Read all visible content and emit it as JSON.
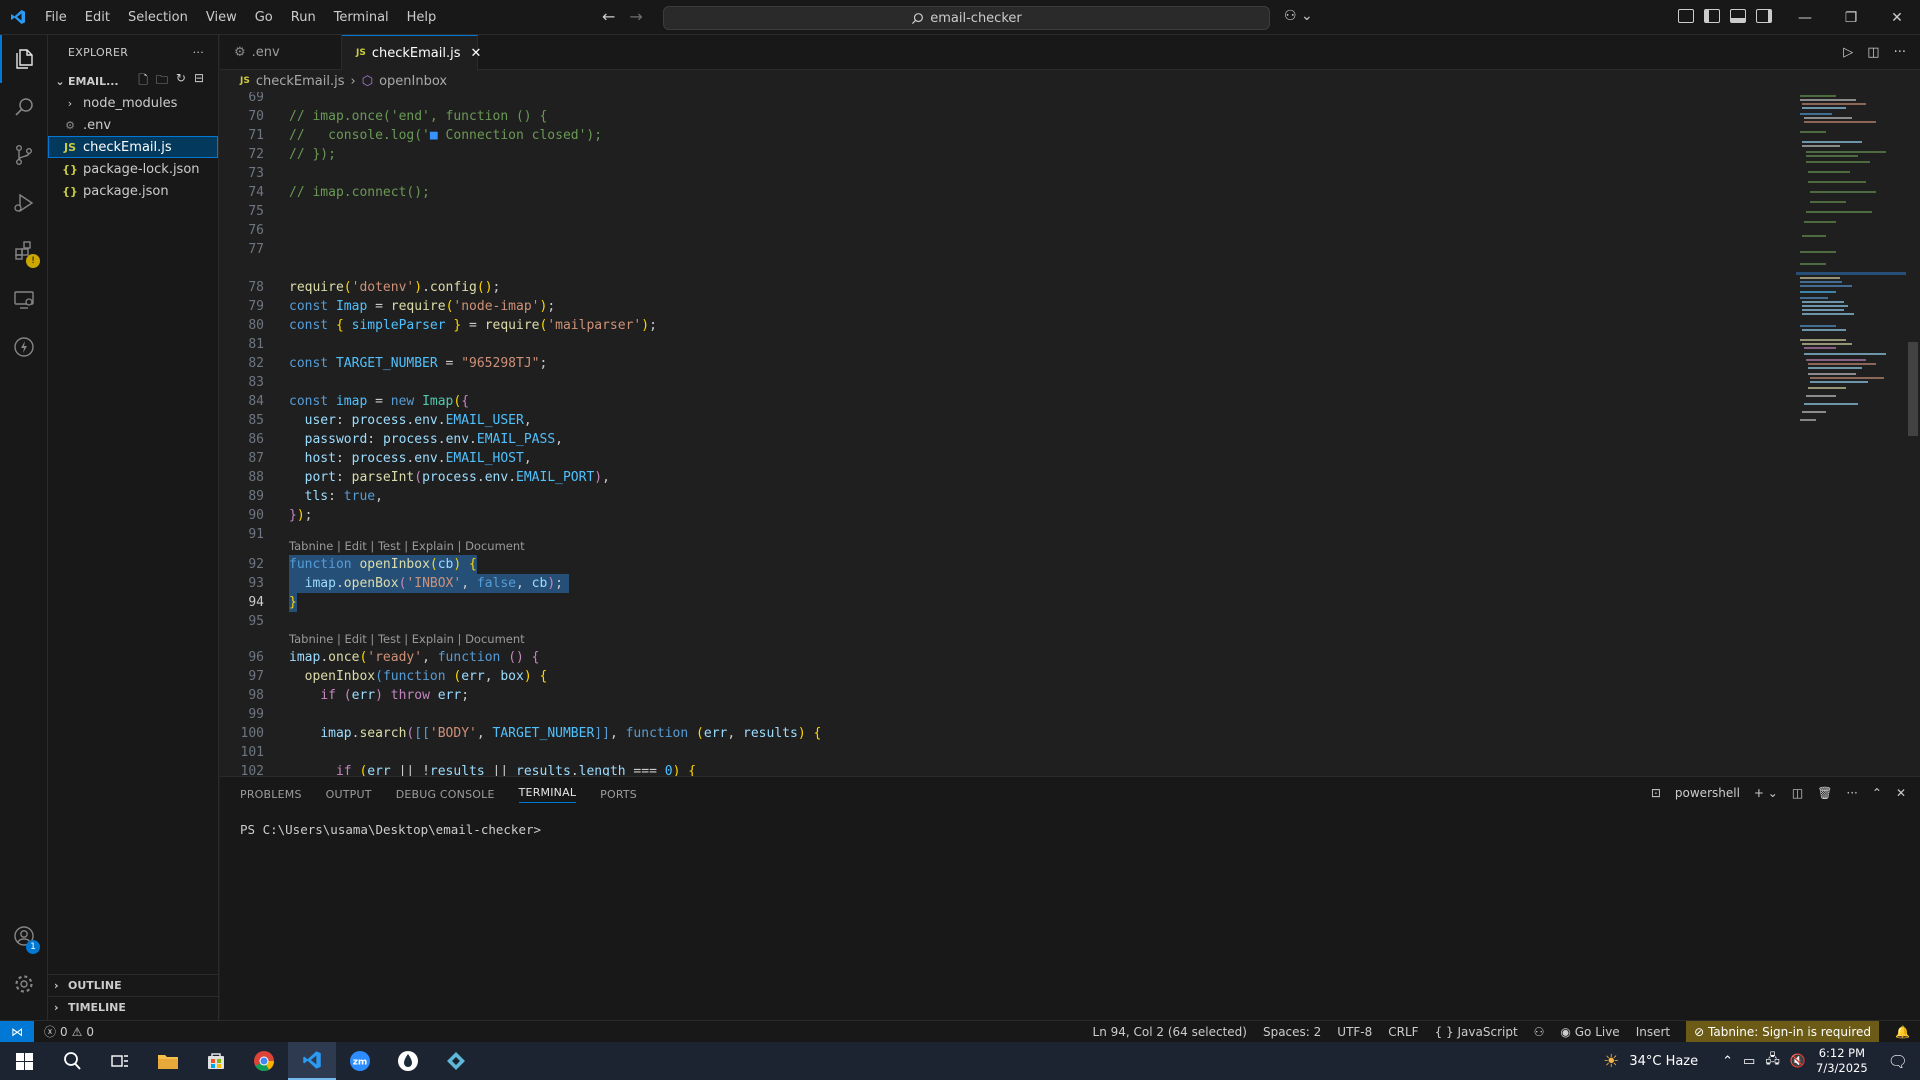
{
  "menu": [
    "File",
    "Edit",
    "Selection",
    "View",
    "Go",
    "Run",
    "Terminal",
    "Help"
  ],
  "search": {
    "text": "email-checker"
  },
  "explorer": {
    "title": "EXPLORER",
    "folder": "EMAIL...",
    "items": [
      {
        "label": "node_modules",
        "type": "folder"
      },
      {
        "label": ".env",
        "type": "env"
      },
      {
        "label": "checkEmail.js",
        "type": "js"
      },
      {
        "label": "package-lock.json",
        "type": "json"
      },
      {
        "label": "package.json",
        "type": "json"
      }
    ],
    "outline": "OUTLINE",
    "timeline": "TIMELINE"
  },
  "tabs": [
    {
      "label": ".env"
    },
    {
      "label": "checkEmail.js"
    }
  ],
  "breadcrumb": {
    "file": "checkEmail.js",
    "symbol": "openInbox"
  },
  "lens": "Tabnine | Edit | Test | Explain | Document",
  "lines": [
    "69",
    "70",
    "71",
    "72",
    "73",
    "74",
    "75",
    "76",
    "77",
    "78",
    "79",
    "80",
    "81",
    "82",
    "83",
    "84",
    "85",
    "86",
    "87",
    "88",
    "89",
    "90",
    "91",
    "92",
    "93",
    "94",
    "95",
    "96",
    "97",
    "98",
    "99",
    "100",
    "101",
    "102"
  ],
  "panel": {
    "tabs": [
      "PROBLEMS",
      "OUTPUT",
      "DEBUG CONSOLE",
      "TERMINAL",
      "PORTS"
    ],
    "shell": "powershell",
    "prompt": "PS C:\\Users\\usama\\Desktop\\email-checker>"
  },
  "status": {
    "errors": "0",
    "warnings": "0",
    "position": "Ln 94, Col 2 (64 selected)",
    "spaces": "Spaces: 2",
    "encoding": "UTF-8",
    "eol": "CRLF",
    "language": "JavaScript",
    "golive": "Go Live",
    "mode": "Insert",
    "tabnine": "Tabnine: Sign-in is required"
  },
  "taskbar": {
    "weather": "34°C  Haze",
    "time": "6:12 PM",
    "date": "7/3/2025"
  },
  "colors": {
    "accent": "#0078d4",
    "selection": "#264f78"
  }
}
